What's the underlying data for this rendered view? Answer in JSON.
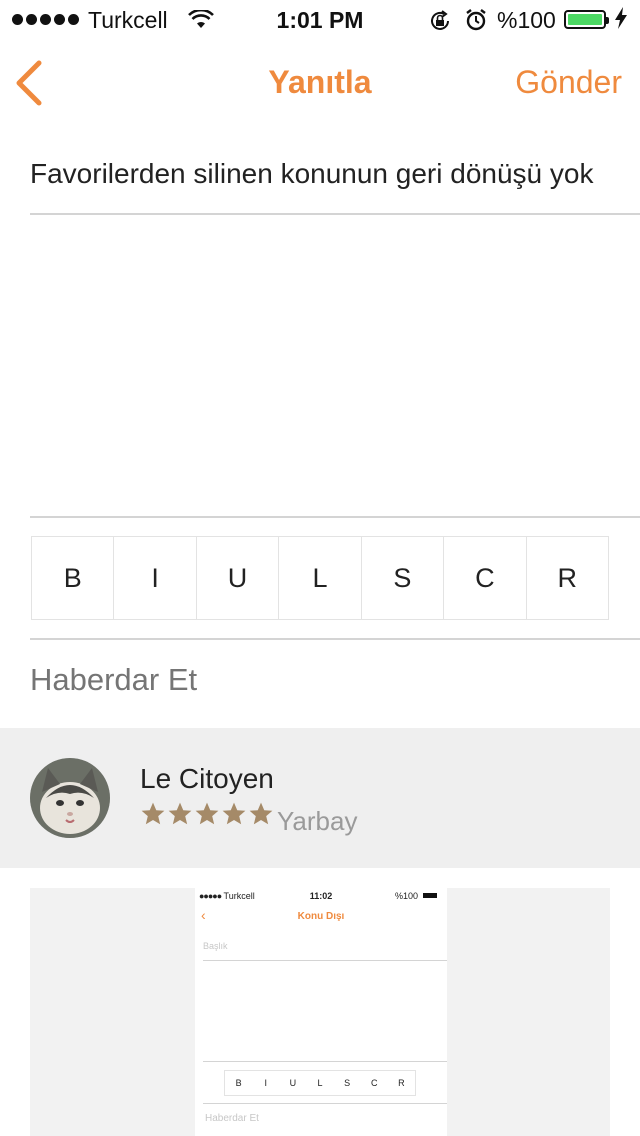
{
  "status_bar": {
    "carrier": "Turkcell",
    "time": "1:01 PM",
    "battery": "%100"
  },
  "nav": {
    "title": "Yanıtla",
    "send_label": "Gönder",
    "accent_color": "#ef8a3e"
  },
  "compose": {
    "subject_value": "Favorilerden silinen konunun geri dönüşü yok",
    "body_value": ""
  },
  "format_toolbar": {
    "buttons": [
      "B",
      "I",
      "U",
      "L",
      "S",
      "C",
      "R"
    ]
  },
  "mention": {
    "placeholder": "Haberdar Et"
  },
  "suggestion": {
    "name": "Le Citoyen",
    "rank": "Yarbay",
    "rating": 5,
    "star_color": "#a58a68"
  },
  "attachment_preview": {
    "carrier": "Turkcell",
    "time": "11:02",
    "battery": "%100",
    "title": "Konu Dışı",
    "subject_placeholder": "Başlık",
    "buttons": [
      "B",
      "I",
      "U",
      "L",
      "S",
      "C",
      "R"
    ],
    "mention_placeholder": "Haberdar Et"
  }
}
